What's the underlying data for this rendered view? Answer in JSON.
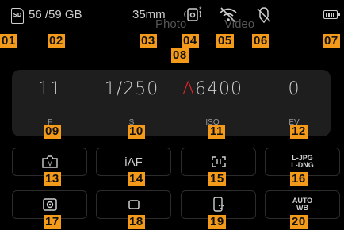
{
  "status_bar": {
    "sd_label": "SD",
    "storage": "56 /59 GB",
    "focal_length": "35mm"
  },
  "mode_switch": {
    "photo": "Photo",
    "video": "Video"
  },
  "exposure": {
    "aperture": {
      "value": "11",
      "label": "F"
    },
    "shutter": {
      "value": "1/250",
      "label": "S"
    },
    "iso": {
      "prefix": "A",
      "value": "6400",
      "label": "ISO"
    },
    "ev": {
      "value": "0",
      "label": "EV"
    }
  },
  "tiles": {
    "af_mode": "iAF",
    "format": {
      "line1": "L-JPG",
      "line2": "L-DNG"
    },
    "white_balance": {
      "line1": "AUTO",
      "line2": "WB"
    }
  },
  "callouts": [
    "01",
    "02",
    "03",
    "04",
    "05",
    "06",
    "07",
    "08",
    "09",
    "10",
    "11",
    "12",
    "13",
    "14",
    "15",
    "16",
    "17",
    "18",
    "19",
    "20"
  ],
  "colors": {
    "callout": "#f39a1b",
    "iso_auto": "#e8252a",
    "panel": "#1e1e1e"
  }
}
